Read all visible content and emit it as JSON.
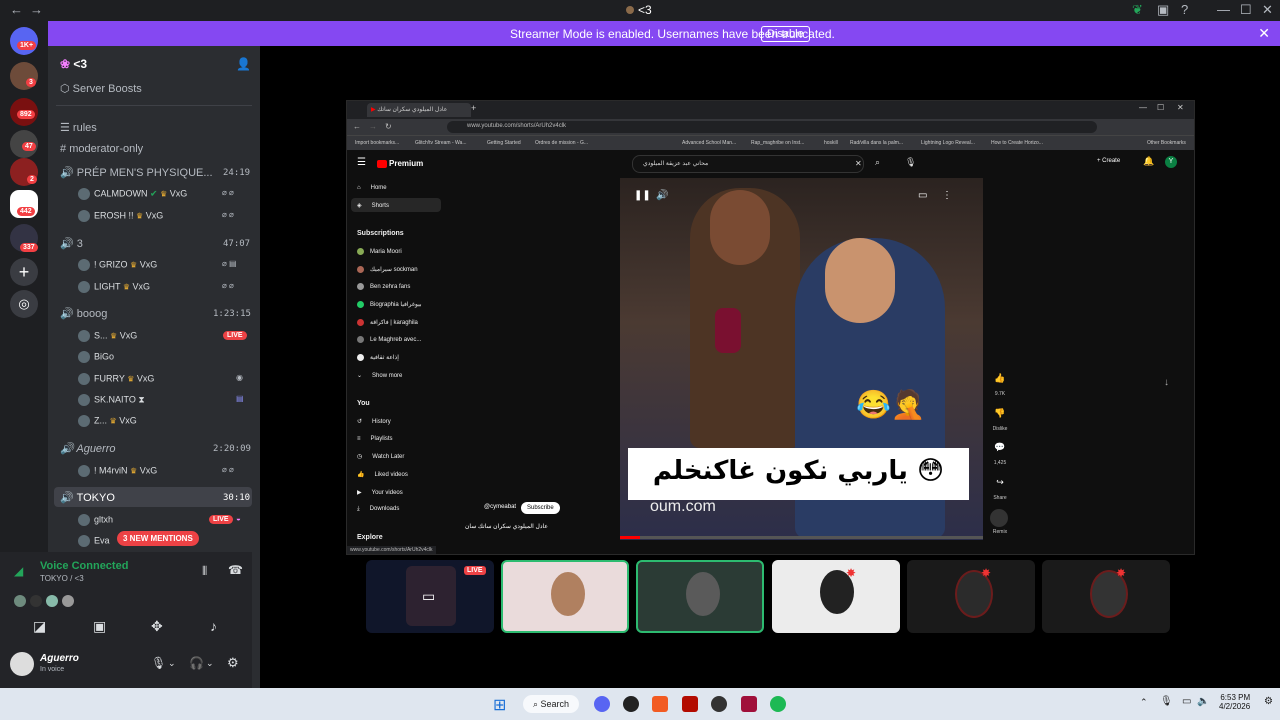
{
  "titlebar": {
    "title": "<3",
    "back": "←",
    "forward": "→"
  },
  "banner": {
    "message": "Streamer Mode is enabled. Usernames have been truncated.",
    "button": "Disable",
    "close": "✕"
  },
  "rail": {
    "badges": [
      "1K+",
      "3",
      "892",
      "47",
      "2",
      "442",
      "337"
    ]
  },
  "server": {
    "name": "<3",
    "boosts": "Server Boosts"
  },
  "channels": {
    "rules": "rules",
    "moderator": "moderator-only"
  },
  "voice_channels": [
    {
      "name": "PRÉP MEN'S PHYSIQUE...",
      "time": "24:19",
      "users": [
        {
          "name": "CALMDOWN",
          "tag": "VxG"
        },
        {
          "name": "EROSH !!",
          "tag": "VxG"
        }
      ]
    },
    {
      "name": "3",
      "time": "47:07",
      "users": [
        {
          "name": "! GRIZO",
          "tag": "VxG"
        },
        {
          "name": "LIGHT",
          "tag": "VxG"
        }
      ]
    },
    {
      "name": "booog",
      "time": "1:23:15",
      "users": [
        {
          "name": "S...",
          "tag": "VxG",
          "live": "LIVE"
        },
        {
          "name": "BiGo"
        },
        {
          "name": "FURRY",
          "tag": "VxG"
        },
        {
          "name": "SK.NAITO"
        },
        {
          "name": "Z...",
          "tag": "VxG"
        }
      ]
    },
    {
      "name": "Aguerro",
      "time": "2:20:09",
      "users": [
        {
          "name": "! M4rviN",
          "tag": "VxG"
        }
      ]
    },
    {
      "name": "TOKYO",
      "time": "30:10",
      "users": [
        {
          "name": "gltxh",
          "live": "LIVE"
        },
        {
          "name": "Eva"
        }
      ]
    }
  ],
  "mentions": "3 NEW MENTIONS",
  "voice_panel": {
    "status": "Voice Connected",
    "location": "TOKYO / <3",
    "user": "Aguerro",
    "user_status": "In voice"
  },
  "share": {
    "tab_title": "عادل الميلودي سكران ساتك",
    "url": "www.youtube.com/shorts/ArUh2v4clk",
    "bookmarks": [
      "Import bookmarks...",
      "Glitch!tv Stream - Wa...",
      "Getting Started",
      "Ordres de mission - G...",
      "Advanced School Man...",
      "Rap_maghribe on Inst...",
      "hoskill",
      "Rad/villa dans la palm...",
      "Lightning Logo Reveal...",
      "How to Create Horizo...",
      "Other Bookmarks"
    ],
    "yt_logo": "Premium",
    "search_query": "محاني عبد عزيقة الميلودي",
    "create": "+ Create",
    "nav": {
      "home": "Home",
      "shorts": "Shorts",
      "subscriptions": "Subscriptions",
      "subs_list": [
        "Maria Moori",
        "سيراميك sockman",
        "Ben zehra fans",
        "Biographia بيوغرافيا",
        "فاكراقة | karaghila",
        "Le Maghreb avec...",
        "إذاعة ثقافية"
      ],
      "show_more": "Show more",
      "you": "You",
      "you_list": [
        "History",
        "Playlists",
        "Watch Later",
        "Liked videos",
        "Your videos",
        "Downloads"
      ],
      "explore": "Explore"
    },
    "caption": "ياربي نكون غاكنخلم 😳",
    "watermark": "oum.com",
    "channel": "@cymeabat",
    "subscribe": "Subscribe",
    "video_title": "عادل الميلودي سكران ساتك سان",
    "likes": "9.7K",
    "dislike": "Dislike",
    "comments": "1,425",
    "share_lbl": "Share",
    "remix": "Remix",
    "status_url": "www.youtube.com/shorts/ArUh2v4clk"
  },
  "tiles": {
    "live": "LIVE"
  },
  "taskbar": {
    "search": "Search",
    "time": "6:53 PM",
    "date": "4/2/2026"
  }
}
